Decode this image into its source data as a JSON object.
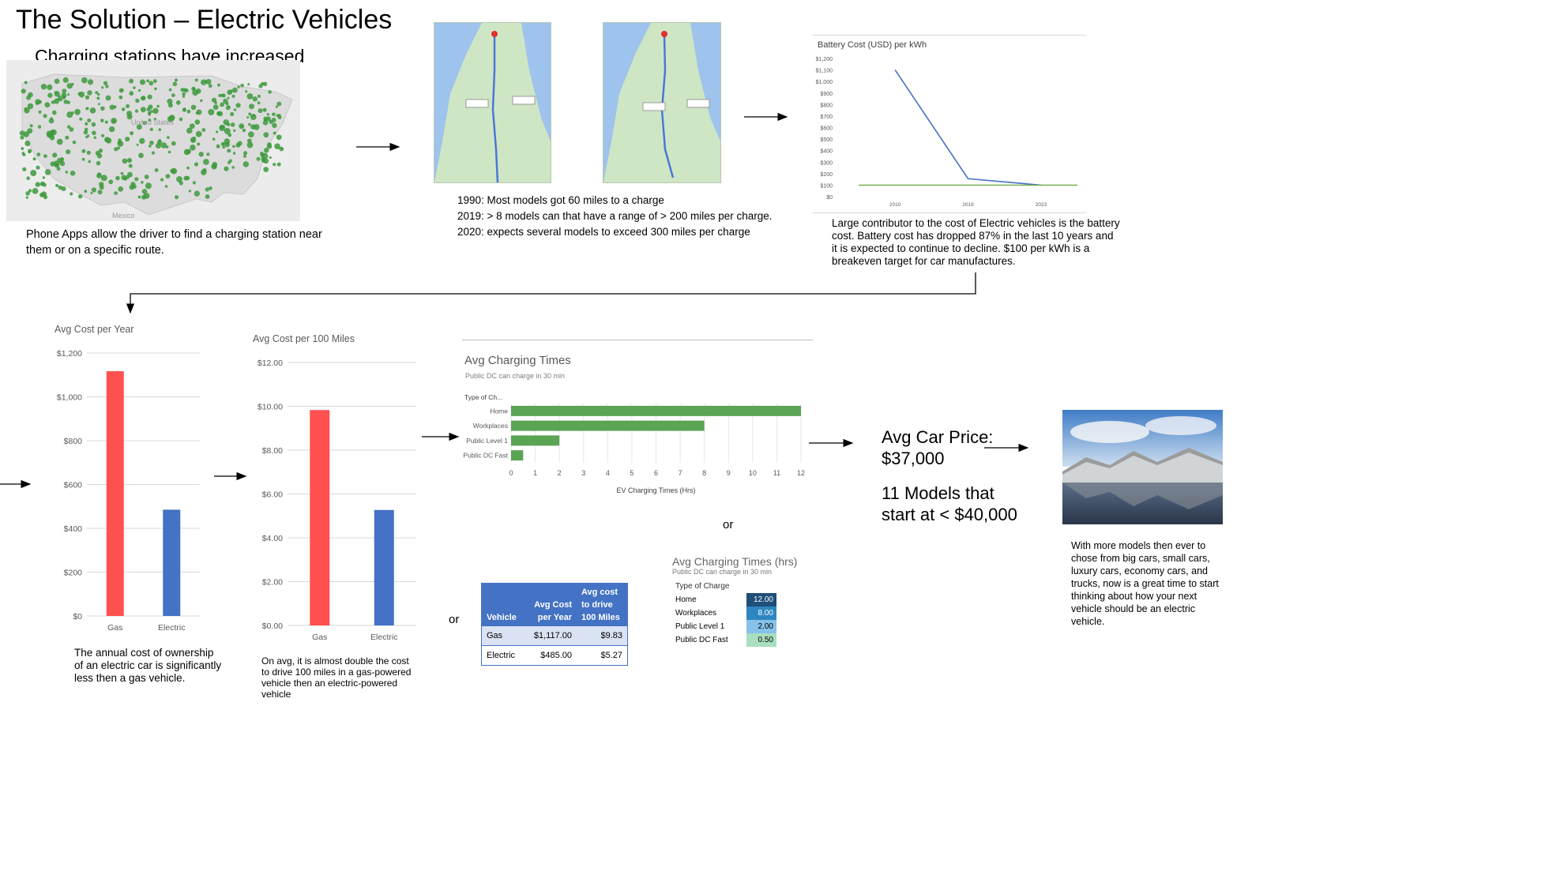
{
  "slide": {
    "title": "The Solution – Electric Vehicles",
    "subtitle": "Charging stations have increased",
    "or_label": "or"
  },
  "map_section": {
    "note": "Phone Apps allow the driver to find a charging station near them or on a specific route.",
    "map_labels": {
      "states": "United States",
      "mexico": "Mexico"
    }
  },
  "route_section": {
    "facts": [
      "1990: Most models got 60 miles to a charge",
      "2019: > 8 models can that have a range of > 200 miles per charge.",
      "2020: expects several models to exceed 300 miles per charge"
    ]
  },
  "battery_section": {
    "note": "Large contributor to the cost of Electric vehicles is the battery cost. Battery cost has dropped 87% in the last 10 years and it is expected to continue to decline.  $100 per kWh is a breakeven target for car manufactures."
  },
  "annual_section": {
    "note": "The annual cost of ownership of an electric car is significantly less then a gas vehicle."
  },
  "miles_section": {
    "note": "On avg, it is almost double the cost to drive 100 miles in a gas-powered vehicle then an electric-powered vehicle"
  },
  "price_section": {
    "line1": "Avg Car Price:",
    "line2": "$37,000",
    "line3": "11 Models that",
    "line4": "start at < $40,000"
  },
  "final_section": {
    "note": "With more models then ever to chose from big cars, small cars, luxury cars, economy  cars, and trucks, now is a great time to start thinking about how your next vehicle should be an electric vehicle."
  },
  "cost_table": {
    "headers": [
      "Vehicle",
      "Avg Cost per Year",
      "Avg cost to drive 100 Miles"
    ],
    "rows": [
      [
        "Gas",
        "$1,117.00",
        "$9.83"
      ],
      [
        "Electric",
        "$485.00",
        "$5.27"
      ]
    ]
  },
  "heat_table": {
    "title": "Avg Charging Times (hrs)",
    "subtitle": "Public DC can charge in 30 min",
    "header": "Type of Charge",
    "rows": [
      [
        "Home",
        "12.00"
      ],
      [
        "Workplaces",
        "8.00"
      ],
      [
        "Public Level 1",
        "2.00"
      ],
      [
        "Public DC Fast",
        "0.50"
      ]
    ]
  },
  "colors": {
    "gas": "#ff5050",
    "electric": "#4472c4",
    "hbar": "#5aa454",
    "battery_line": "#4472c4",
    "target_line": "#70ad47"
  },
  "chart_data": [
    {
      "id": "battery",
      "type": "line",
      "title": "Battery Cost (USD) per kWh",
      "categories": [
        "2010",
        "2019",
        "2023"
      ],
      "series": [
        {
          "values": [
            1100,
            156,
            100
          ]
        },
        {
          "values": [
            100,
            100,
            100
          ]
        }
      ],
      "ylim": [
        0,
        1200
      ],
      "yticks": [
        "$0",
        "$100",
        "$200",
        "$300",
        "$400",
        "$500",
        "$600",
        "$700",
        "$800",
        "$900",
        "$1,000",
        "$1,100",
        "$1,200"
      ],
      "grid": false
    },
    {
      "id": "annual",
      "type": "bar",
      "title": "Avg Cost per Year",
      "categories": [
        "Gas",
        "Electric"
      ],
      "values": [
        1117,
        485
      ],
      "ylim": [
        0,
        1200
      ],
      "yticks": [
        "$0",
        "$200",
        "$400",
        "$600",
        "$800",
        "$1,000",
        "$1,200"
      ],
      "grid": true
    },
    {
      "id": "miles",
      "type": "bar",
      "title": "Avg Cost per 100 Miles",
      "categories": [
        "Gas",
        "Electric"
      ],
      "values": [
        9.83,
        5.27
      ],
      "ylim": [
        0,
        12
      ],
      "yticks": [
        "$0.00",
        "$2.00",
        "$4.00",
        "$6.00",
        "$8.00",
        "$10.00",
        "$12.00"
      ],
      "grid": true
    },
    {
      "id": "charging",
      "type": "bar",
      "orientation": "horizontal",
      "title": "Avg Charging Times",
      "subtitle": "Public DC can charge in 30 min",
      "axis_header": "Type of Ch...",
      "xlabel": "EV Charging Times (Hrs)",
      "categories": [
        "Home",
        "Workplaces",
        "Public Level 1",
        "Public DC Fast"
      ],
      "values": [
        12,
        8,
        2,
        0.5
      ],
      "xlim": [
        0,
        12
      ],
      "xticks": [
        "0",
        "1",
        "2",
        "3",
        "4",
        "5",
        "6",
        "7",
        "8",
        "9",
        "10",
        "11",
        "12"
      ],
      "grid": true
    }
  ]
}
